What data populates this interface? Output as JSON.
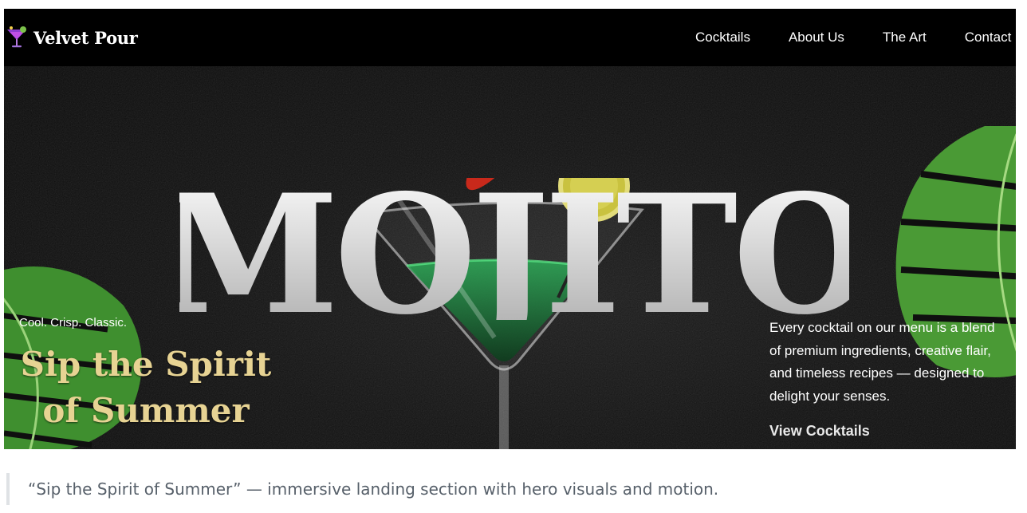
{
  "brand": {
    "name": "Velvet Pour",
    "logo_icon": "cocktail-glass-icon"
  },
  "nav": {
    "items": [
      {
        "label": "Cocktails"
      },
      {
        "label": "About Us"
      },
      {
        "label": "The Art"
      },
      {
        "label": "Contact"
      }
    ]
  },
  "hero": {
    "title": "MOJITO",
    "tagline": "Cool. Crisp. Classic.",
    "headline_line1": "Sip the Spirit",
    "headline_line2": "of Summer",
    "description": "Every cocktail on our menu is a blend of premium ingredients, creative flair, and timeless recipes — designed to delight your senses.",
    "cta_label": "View Cocktails"
  },
  "caption": "“Sip the Spirit of Summer” — immersive landing section with hero visuals and motion.",
  "colors": {
    "accent_gold": "#e7d393",
    "background": "#0b0b0b",
    "leaf_green": "#3f8f2f"
  }
}
